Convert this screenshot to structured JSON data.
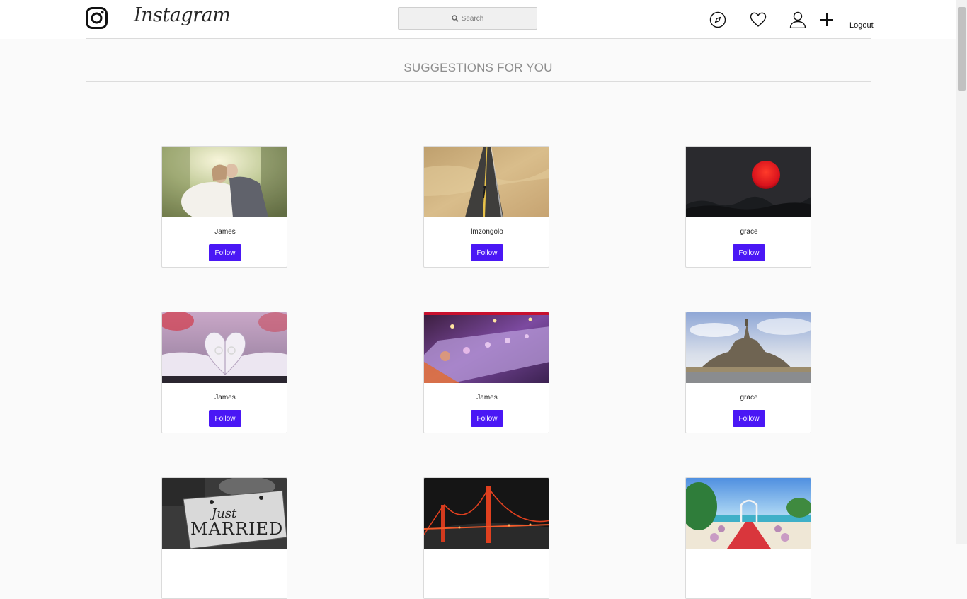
{
  "header": {
    "brand": "Instagram",
    "search_placeholder": "Search",
    "logout_label": "Logout",
    "icons": [
      "instagram-logo-icon",
      "compass-icon",
      "heart-icon",
      "user-icon",
      "plus-icon"
    ]
  },
  "section": {
    "title": "SUGGESTIONS FOR YOU"
  },
  "follow_label": "Follow",
  "suggestions": [
    {
      "name": "James",
      "photo": "wedding-couple-kissing-photo"
    },
    {
      "name": "lmzongolo",
      "photo": "desert-road-photo"
    },
    {
      "name": "grace",
      "photo": "red-sun-night-photo"
    },
    {
      "name": "James",
      "photo": "book-heart-rings-photo"
    },
    {
      "name": "James",
      "photo": "banquet-table-photo"
    },
    {
      "name": "grace",
      "photo": "mont-saint-michel-photo"
    },
    {
      "name": "",
      "photo": "just-married-sign-photo"
    },
    {
      "name": "",
      "photo": "golden-gate-bridge-night-photo"
    },
    {
      "name": "",
      "photo": "beach-wedding-aisle-photo"
    }
  ],
  "sign_text": {
    "line1": "Just",
    "line2": "MARRIED"
  },
  "colors": {
    "follow_button": "#4a17f5",
    "page_background": "#fafafa",
    "heading_text": "#8e8e8e"
  }
}
